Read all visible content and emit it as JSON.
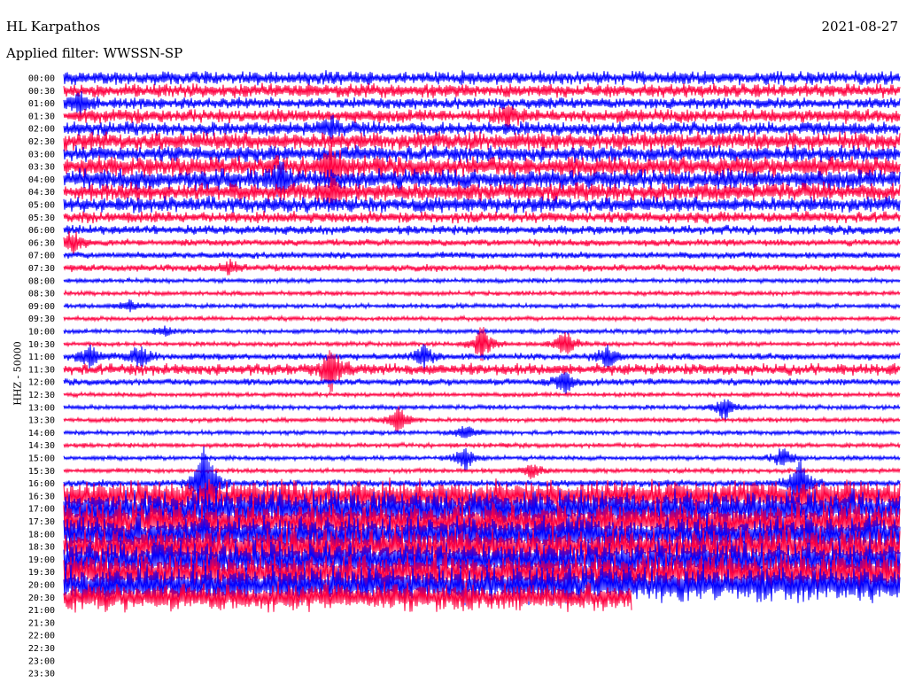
{
  "header": {
    "station": "HL Karpathos",
    "filter": "Applied filter: WWSSN-SP",
    "date": "2021-08-27"
  },
  "chart_data": {
    "type": "line",
    "title": "HL Karpathos",
    "subtitle": "Applied filter: WWSSN-SP",
    "ylabel": "HHZ - 50000",
    "colors": [
      "#0000ff",
      "#ff0040"
    ],
    "row_minutes": 30,
    "tick_labels": [
      "00:00",
      "00:30",
      "01:00",
      "01:30",
      "02:00",
      "02:30",
      "03:00",
      "03:30",
      "04:00",
      "04:30",
      "05:00",
      "05:30",
      "06:00",
      "06:30",
      "07:00",
      "07:30",
      "08:00",
      "08:30",
      "09:00",
      "09:30",
      "10:00",
      "10:30",
      "11:00",
      "11:30",
      "12:00",
      "12:30",
      "13:00",
      "13:30",
      "14:00",
      "14:30",
      "15:00",
      "15:30",
      "16:00",
      "16:30",
      "17:00",
      "17:30",
      "18:00",
      "18:30",
      "19:00",
      "19:30",
      "20:00",
      "20:30",
      "21:00",
      "21:30",
      "22:00",
      "22:30",
      "23:00",
      "23:30"
    ],
    "data_end_fraction_of_last_row": 0.68,
    "row_noise_level": [
      6,
      6,
      5,
      6,
      6,
      8,
      7,
      9,
      9,
      8,
      7,
      5,
      4,
      3,
      3,
      3,
      2,
      2,
      2,
      2,
      2,
      2,
      3,
      5,
      3,
      2,
      2,
      2,
      2,
      2,
      2,
      2,
      3,
      14,
      16,
      16,
      16,
      16,
      16,
      16,
      16,
      12
    ],
    "events": [
      [
        2,
        0.02,
        14
      ],
      [
        3,
        0.53,
        12
      ],
      [
        4,
        0.32,
        10
      ],
      [
        7,
        0.32,
        22
      ],
      [
        8,
        0.26,
        14
      ],
      [
        9,
        0.32,
        16
      ],
      [
        13,
        0.01,
        16
      ],
      [
        15,
        0.2,
        8
      ],
      [
        18,
        0.08,
        8
      ],
      [
        20,
        0.12,
        6
      ],
      [
        21,
        0.5,
        22
      ],
      [
        21,
        0.6,
        18
      ],
      [
        22,
        0.03,
        14
      ],
      [
        22,
        0.09,
        14
      ],
      [
        22,
        0.43,
        14
      ],
      [
        22,
        0.65,
        14
      ],
      [
        23,
        0.32,
        28
      ],
      [
        24,
        0.6,
        16
      ],
      [
        26,
        0.79,
        14
      ],
      [
        27,
        0.4,
        18
      ],
      [
        28,
        0.48,
        10
      ],
      [
        30,
        0.48,
        16
      ],
      [
        30,
        0.86,
        14
      ],
      [
        31,
        0.56,
        10
      ],
      [
        32,
        0.17,
        60
      ],
      [
        32,
        0.88,
        30
      ]
    ]
  }
}
